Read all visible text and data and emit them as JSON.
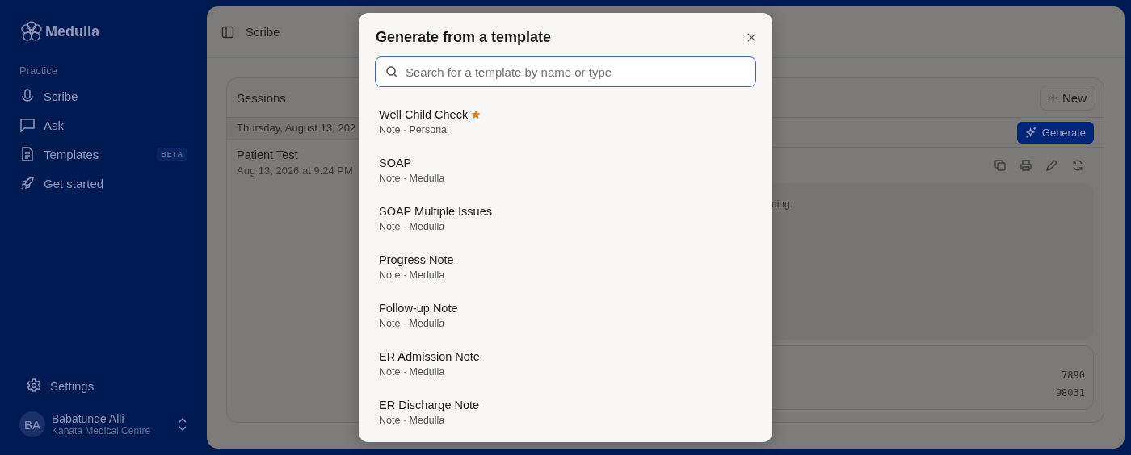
{
  "sidebar": {
    "brand": "Medulla",
    "section": "Practice",
    "items": [
      {
        "label": "Scribe",
        "kind": "mic"
      },
      {
        "label": "Ask",
        "kind": "chat"
      },
      {
        "label": "Templates",
        "kind": "doc",
        "badge": "BETA"
      },
      {
        "label": "Get started",
        "kind": "rocket"
      }
    ],
    "settings": "Settings",
    "user": {
      "initials": "BA",
      "name": "Babatunde Alli",
      "org": "Kanata Medical Centre"
    }
  },
  "header": {
    "title": "Scribe"
  },
  "sessions": {
    "title": "Sessions",
    "new_button": "New",
    "date_heading": "Thursday, August 13, 202",
    "items": [
      {
        "name": "Patient Test",
        "time": "Aug 13, 2026 at 9:24 PM"
      }
    ]
  },
  "detail": {
    "generate_button": "Generate",
    "note_fragment": "ding.",
    "codes": [
      "7890",
      "98031"
    ]
  },
  "modal": {
    "title": "Generate from a template",
    "search": {
      "placeholder": "Search for a template by name or type"
    },
    "templates": [
      {
        "name": "Well Child Check",
        "meta": "Note · Personal",
        "starred": true
      },
      {
        "name": "SOAP",
        "meta": "Note · Medulla",
        "starred": false
      },
      {
        "name": "SOAP Multiple Issues",
        "meta": "Note · Medulla",
        "starred": false
      },
      {
        "name": "Progress Note",
        "meta": "Note · Medulla",
        "starred": false
      },
      {
        "name": "Follow-up Note",
        "meta": "Note · Medulla",
        "starred": false
      },
      {
        "name": "ER Admission Note",
        "meta": "Note · Medulla",
        "starred": false
      },
      {
        "name": "ER Discharge Note",
        "meta": "Note · Medulla",
        "starred": false
      }
    ]
  }
}
